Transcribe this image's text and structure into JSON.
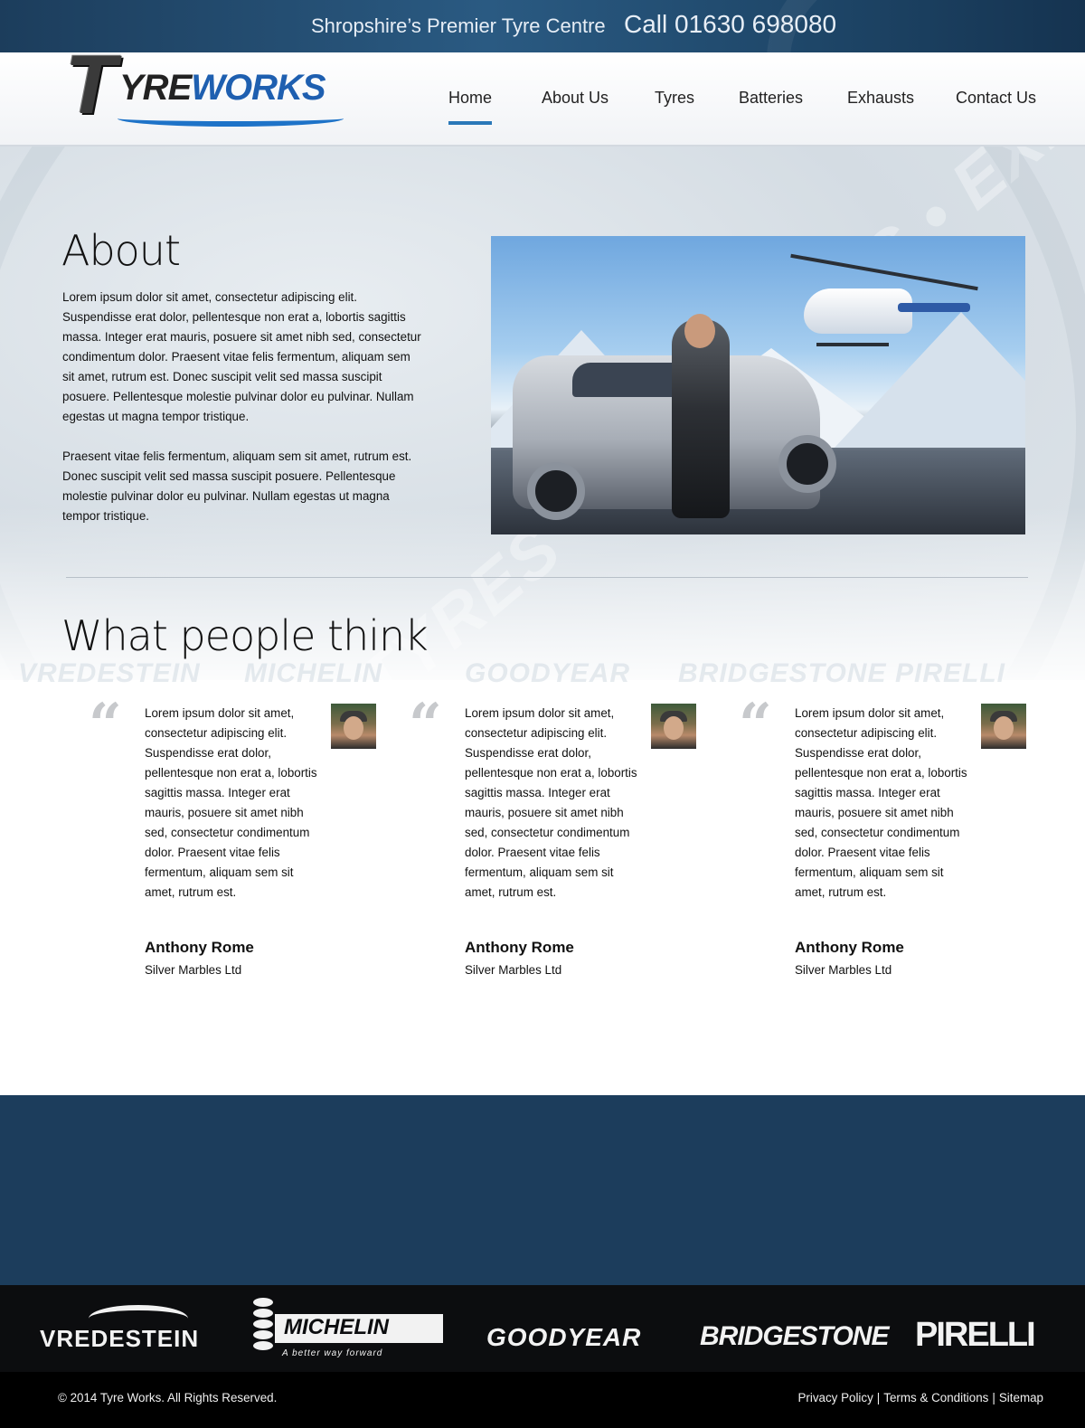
{
  "topbar": {
    "tagline": "Shropshire’s Premier Tyre Centre",
    "phone": "Call 01630 698080"
  },
  "logo": {
    "letter": "T",
    "word_a": "YRE",
    "word_b": "WORKS"
  },
  "nav": {
    "items": [
      {
        "label": "Home",
        "active": true
      },
      {
        "label": "About Us"
      },
      {
        "label": "Tyres"
      },
      {
        "label": "Batteries"
      },
      {
        "label": "Exhausts"
      },
      {
        "label": "Contact Us"
      }
    ]
  },
  "watermark": "TYRES • BATTERIES • EXHAUSTS",
  "about": {
    "title": "About",
    "paragraphs": [
      "Lorem ipsum dolor sit amet, consectetur adipiscing elit. Suspendisse erat dolor, pellentesque non erat a, lobortis sagittis massa. Integer erat mauris, posuere sit amet nibh sed, consectetur condimentum dolor. Praesent vitae felis fermentum, aliquam sem sit amet, rutrum est. Donec suscipit velit sed massa suscipit posuere. Pellentesque molestie pulvinar dolor eu pulvinar. Nullam egestas ut magna tempor tristique.",
      "Praesent vitae felis fermentum, aliquam sem sit amet, rutrum est. Donec suscipit velit sed massa suscipit posuere. Pellentesque molestie pulvinar dolor eu pulvinar. Nullam egestas ut magna tempor tristique."
    ]
  },
  "testimonials_section": {
    "title": "What people think",
    "items": [
      {
        "quote_mark": "“",
        "text": "Lorem ipsum dolor sit amet, consectetur adipiscing elit. Suspendisse erat dolor, pellentesque non erat a, lobortis sagittis massa. Integer erat mauris, posuere sit amet nibh sed, consectetur condimentum dolor. Praesent vitae felis fermentum, aliquam sem sit amet, rutrum est.",
        "name": "Anthony Rome",
        "company": "Silver Marbles Ltd"
      },
      {
        "quote_mark": "“",
        "text": "Lorem ipsum dolor sit amet, consectetur adipiscing elit. Suspendisse erat dolor, pellentesque non erat a, lobortis sagittis massa. Integer erat mauris, posuere sit amet nibh sed, consectetur condimentum dolor. Praesent vitae felis fermentum, aliquam sem sit amet, rutrum est.",
        "name": "Anthony Rome",
        "company": "Silver Marbles Ltd"
      },
      {
        "quote_mark": "“",
        "text": "Lorem ipsum dolor sit amet, consectetur adipiscing elit. Suspendisse erat dolor, pellentesque non erat a, lobortis sagittis massa. Integer erat mauris, posuere sit amet nibh sed, consectetur condimentum dolor. Praesent vitae felis fermentum, aliquam sem sit amet, rutrum est.",
        "name": "Anthony Rome",
        "company": "Silver Marbles Ltd"
      }
    ]
  },
  "brands": {
    "vredestein": "VREDESTEIN",
    "michelin": "MICHELIN",
    "michelin_tagline": "A better way forward",
    "goodyear": "GOODYEAR",
    "bridgestone": "BRIDGESTONE",
    "pirelli": "PIRELLI"
  },
  "footer": {
    "copyright": "© 2014 Tyre Works. All Rights Reserved.",
    "links": [
      "Privacy Policy",
      "Terms & Conditions",
      "Sitemap"
    ],
    "separator": "|"
  },
  "colors": {
    "brand_blue": "#1c3d5c",
    "accent": "#2a78b8",
    "logo_blue": "#1e5fb0"
  }
}
